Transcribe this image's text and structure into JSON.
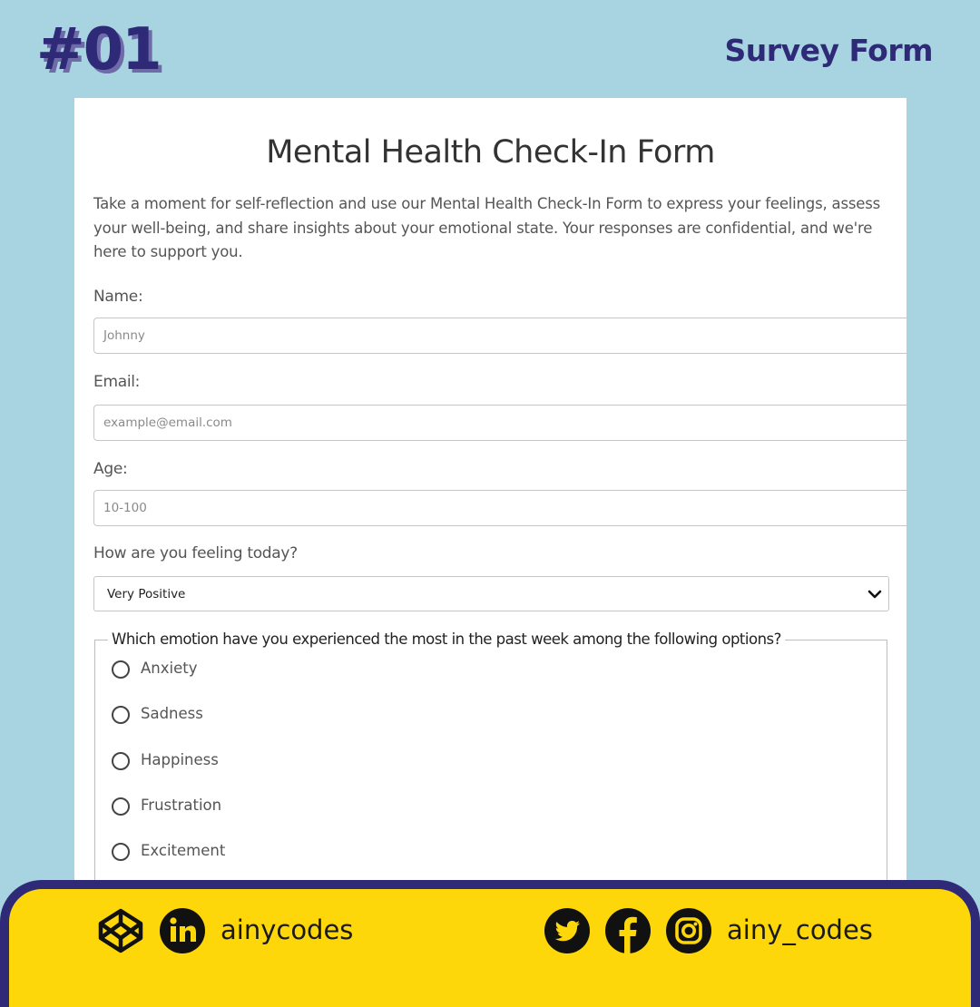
{
  "header": {
    "badge": "#01",
    "title": "Survey Form"
  },
  "form": {
    "title": "Mental Health Check-In Form",
    "intro": "Take a moment for self-reflection and use our Mental Health Check-In Form to express your feelings, assess your well-being, and share insights about your emotional state. Your responses are confidential, and we're here to support you.",
    "fields": {
      "name": {
        "label": "Name:",
        "placeholder": "Johnny"
      },
      "email": {
        "label": "Email:",
        "placeholder": "example@email.com"
      },
      "age": {
        "label": "Age:",
        "placeholder": "10-100"
      }
    },
    "feeling": {
      "label": "How are you feeling today?",
      "selected": "Very Positive"
    },
    "emotion": {
      "legend": "Which emotion have you experienced the most in the past week among the following options?",
      "options": [
        "Anxiety",
        "Sadness",
        "Happiness",
        "Frustration",
        "Excitement"
      ]
    }
  },
  "footer": {
    "left_handle": "ainycodes",
    "right_handle": "ainy_codes",
    "icons": [
      "codepen-icon",
      "linkedin-icon",
      "twitter-icon",
      "facebook-icon",
      "instagram-icon"
    ]
  },
  "colors": {
    "background": "#a8d3e1",
    "brand_navy": "#2f2a78",
    "footer_yellow": "#fdd70a"
  }
}
